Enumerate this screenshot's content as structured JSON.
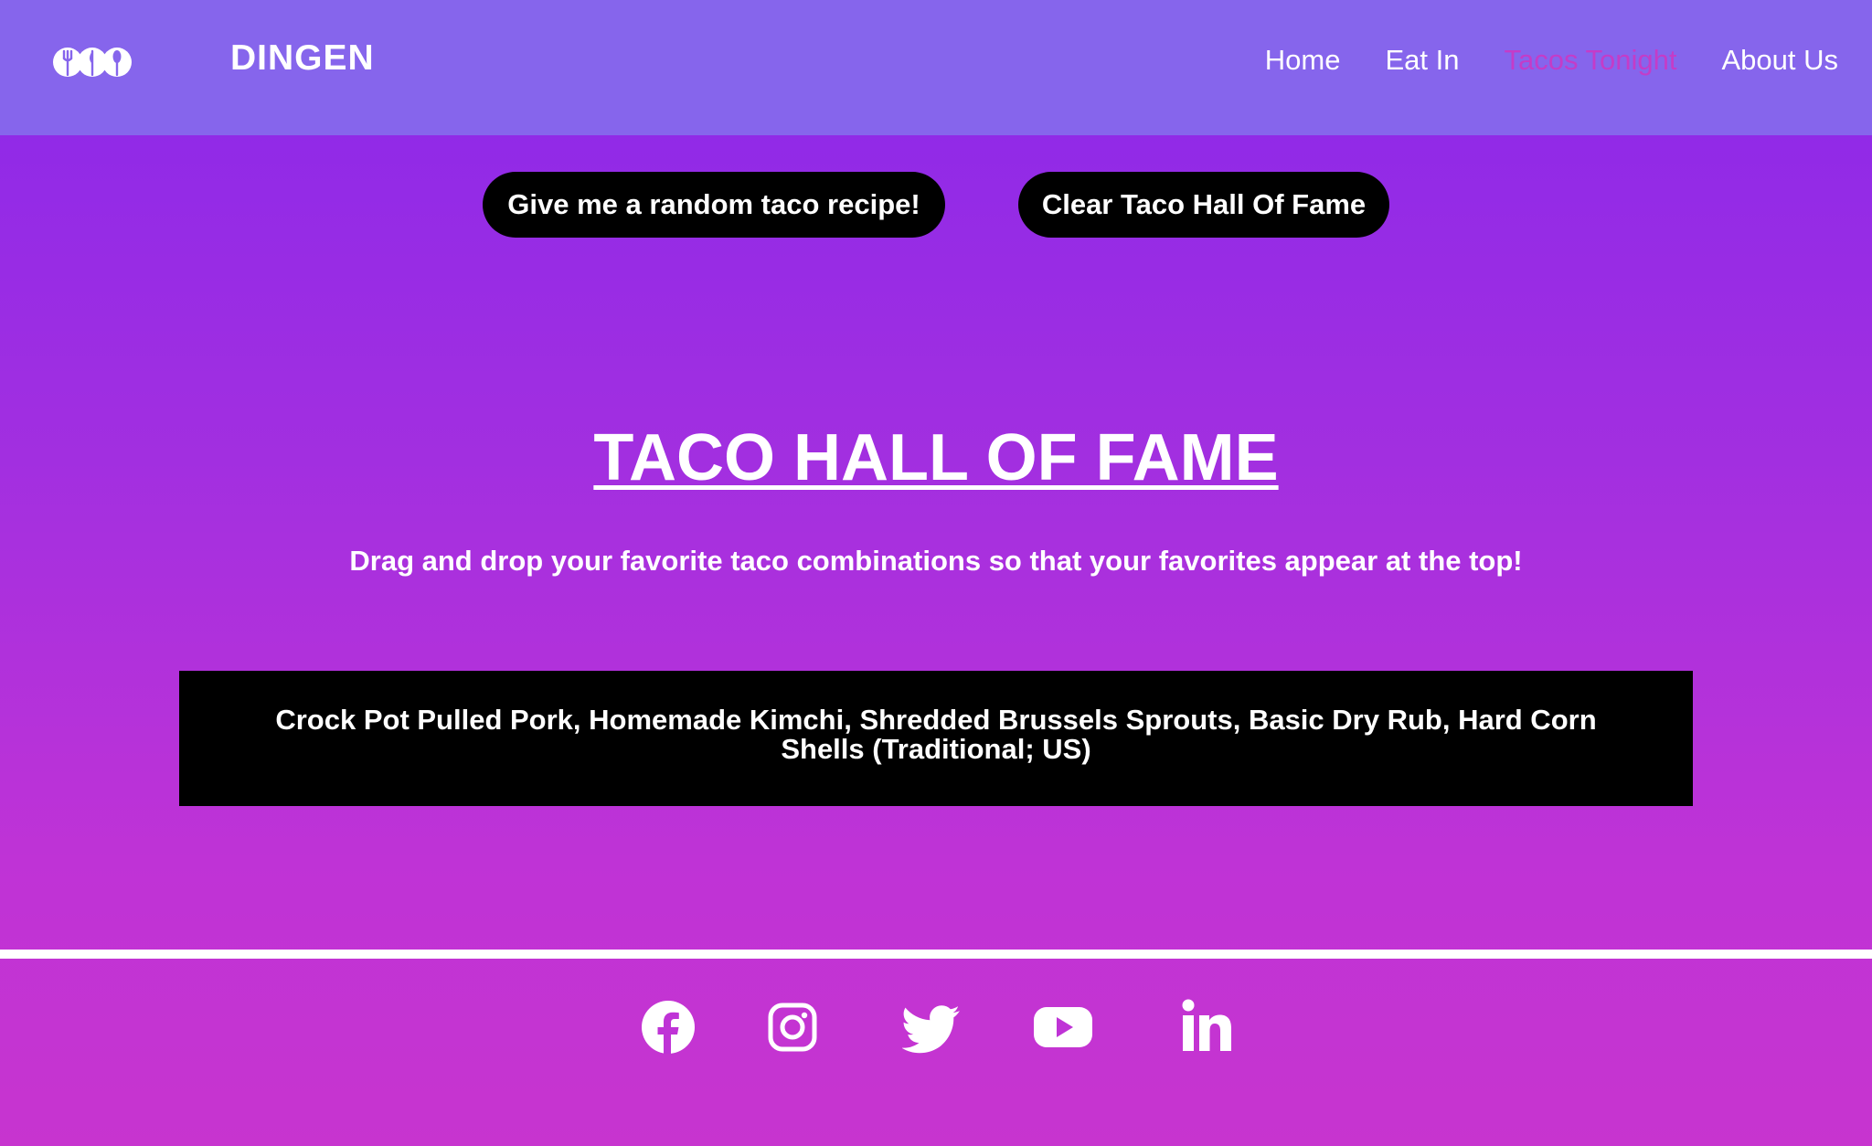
{
  "header": {
    "brand": "DINGEN",
    "logo_icon": "utensils-logo-icon",
    "nav": [
      {
        "label": "Home",
        "active": false
      },
      {
        "label": "Eat In",
        "active": false
      },
      {
        "label": "Tacos Tonight",
        "active": true
      },
      {
        "label": "About Us",
        "active": false
      }
    ],
    "colors": {
      "background": "#8665ec",
      "active_link": "#c43cc8"
    }
  },
  "actions": {
    "random_label": "Give me a random taco recipe!",
    "clear_label": "Clear Taco Hall Of Fame"
  },
  "main": {
    "title": "TACO HALL OF FAME",
    "subtitle": "Drag and drop your favorite taco combinations so that your favorites appear at the top!",
    "items": [
      "Crock Pot Pulled Pork, Homemade Kimchi, Shredded Brussels Sprouts, Basic Dry Rub, Hard Corn Shells (Traditional; US)"
    ]
  },
  "footer": {
    "social": [
      "facebook-icon",
      "instagram-icon",
      "twitter-icon",
      "youtube-icon",
      "linkedin-icon"
    ]
  },
  "colors": {
    "gradient_top": "#8a28ea",
    "gradient_bottom": "#c734cf",
    "button_bg": "#000000",
    "text": "#ffffff"
  }
}
